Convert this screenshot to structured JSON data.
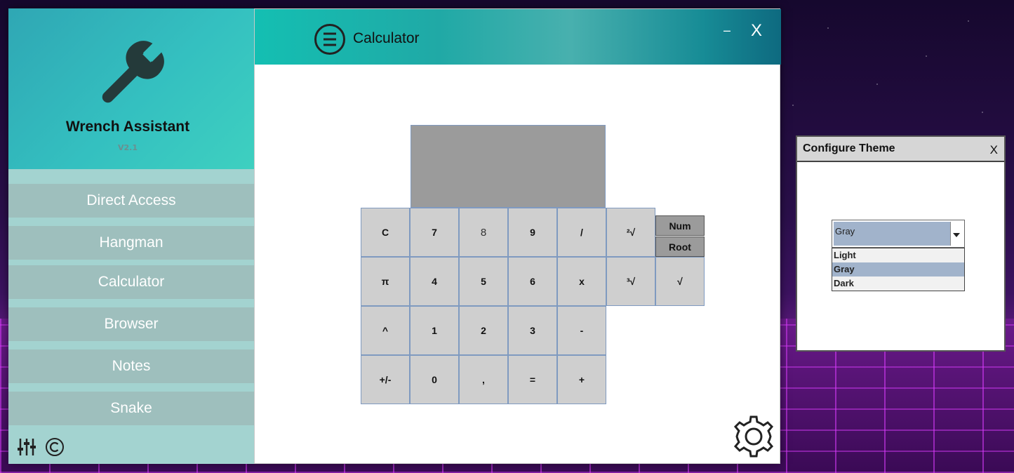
{
  "sidebar": {
    "app_name": "Wrench Assistant",
    "version": "V2.1",
    "items": [
      {
        "label": "Direct Access"
      },
      {
        "label": "Hangman"
      },
      {
        "label": "Calculator"
      },
      {
        "label": "Browser"
      },
      {
        "label": "Notes"
      },
      {
        "label": "Snake"
      }
    ],
    "footer_icons": [
      "settings-sliders-icon",
      "copyright-icon"
    ]
  },
  "titlebar": {
    "title": "Calculator",
    "minimize_label": "–",
    "close_label": "X",
    "menu_icon": "hamburger-circle-icon"
  },
  "calculator": {
    "display_value": "",
    "keys": [
      [
        "C",
        "7",
        "8",
        "9",
        "/",
        "²√"
      ],
      [
        "π",
        "4",
        "5",
        "6",
        "x",
        "³√",
        "√"
      ],
      [
        "^",
        "1",
        "2",
        "3",
        "-"
      ],
      [
        "+/-",
        "0",
        ",",
        "=",
        "+"
      ]
    ],
    "mode_buttons": [
      "Num",
      "Root"
    ],
    "settings_icon": "gear-icon"
  },
  "theme_dialog": {
    "title": "Configure Theme",
    "close_label": "X",
    "selected": "Gray",
    "options": [
      "Light",
      "Gray",
      "Dark"
    ]
  },
  "colors": {
    "sidebar_header": "#34c0c0",
    "nav_item": "#9ebfbd",
    "titlebar_accent": "#14bfb2",
    "key_bg": "#cfcfcf",
    "display_bg": "#9b9b9b",
    "selection": "#a1b3cb"
  }
}
